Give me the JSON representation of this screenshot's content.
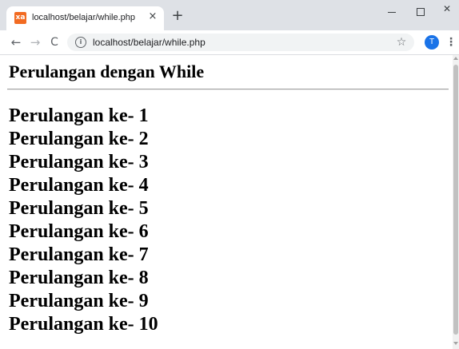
{
  "browser": {
    "tab": {
      "favicon_glyph": "xa",
      "title": "localhost/belajar/while.php",
      "close_glyph": "×"
    },
    "new_tab_glyph": "+",
    "window_controls": {
      "close_glyph": "✕"
    },
    "toolbar": {
      "back_glyph": "←",
      "forward_glyph": "→",
      "reload_glyph": "C",
      "info_glyph": "i",
      "url": "localhost/belajar/while.php",
      "star_glyph": "☆",
      "avatar_letter": "T",
      "menu_glyph": "⋮"
    },
    "colors": {
      "accent": "#1a73e8",
      "favicon": "#f26b22",
      "tabstrip": "#dee1e6"
    }
  },
  "page": {
    "heading": "Perulangan dengan While",
    "items": [
      "Perulangan ke- 1",
      "Perulangan ke- 2",
      "Perulangan ke- 3",
      "Perulangan ke- 4",
      "Perulangan ke- 5",
      "Perulangan ke- 6",
      "Perulangan ke- 7",
      "Perulangan ke- 8",
      "Perulangan ke- 9",
      "Perulangan ke- 10"
    ]
  }
}
